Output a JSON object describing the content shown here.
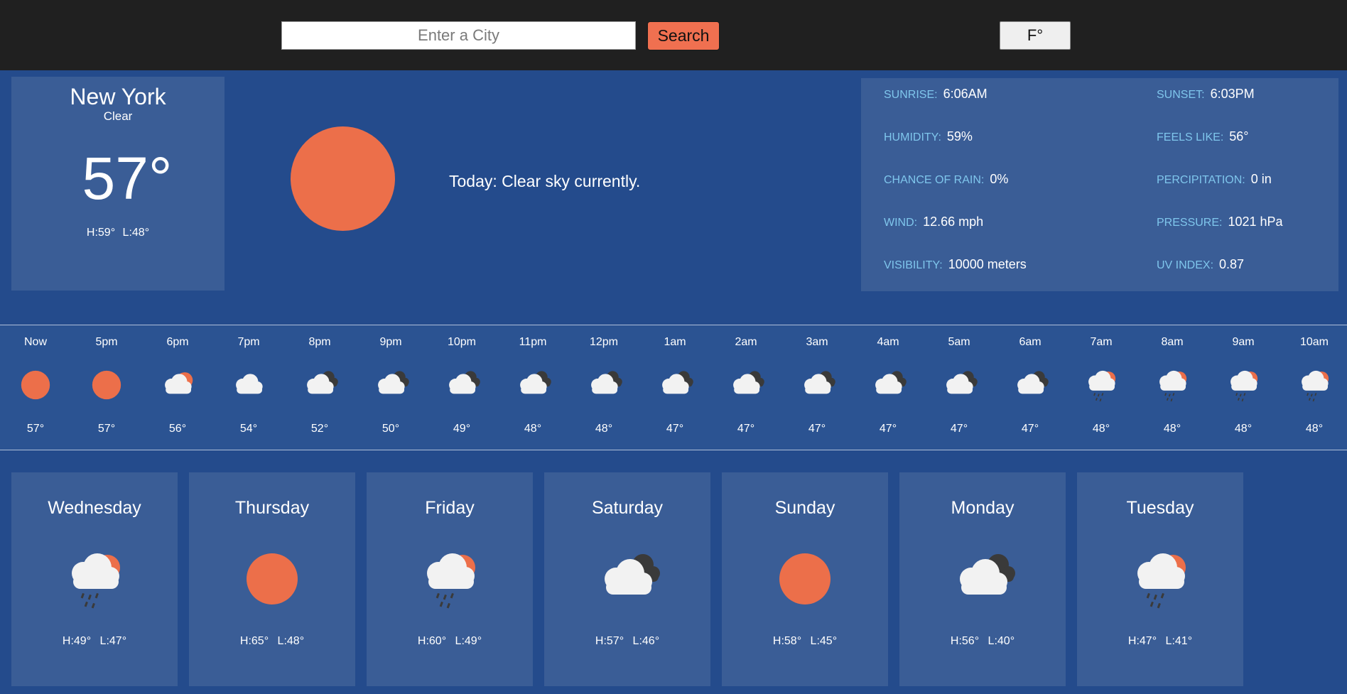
{
  "search": {
    "placeholder": "Enter a City",
    "button_label": "Search"
  },
  "unit_toggle": {
    "label": "F°"
  },
  "current": {
    "city": "New York",
    "condition": "Clear",
    "temp": "57°",
    "high": "H:59°",
    "low": "L:48°",
    "icon": "sun-icon",
    "summary": "Today: Clear sky currently."
  },
  "details": [
    {
      "label": "SUNRISE:",
      "value": "6:06AM"
    },
    {
      "label": "SUNSET:",
      "value": "6:03PM"
    },
    {
      "label": "HUMIDITY:",
      "value": "59%"
    },
    {
      "label": "FEELS LIKE:",
      "value": "56°"
    },
    {
      "label": "CHANCE OF RAIN:",
      "value": "0%"
    },
    {
      "label": "PERCIPITATION:",
      "value": "0 in"
    },
    {
      "label": "WIND:",
      "value": "12.66 mph"
    },
    {
      "label": "PRESSURE:",
      "value": "1021 hPa"
    },
    {
      "label": "VISIBILITY:",
      "value": "10000 meters"
    },
    {
      "label": "UV INDEX:",
      "value": "0.87"
    }
  ],
  "hourly": [
    {
      "time": "Now",
      "temp": "57°",
      "icon": "sun-icon"
    },
    {
      "time": "5pm",
      "temp": "57°",
      "icon": "sun-icon"
    },
    {
      "time": "6pm",
      "temp": "56°",
      "icon": "partly-cloudy-icon"
    },
    {
      "time": "7pm",
      "temp": "54°",
      "icon": "cloud-icon"
    },
    {
      "time": "8pm",
      "temp": "52°",
      "icon": "overcast-icon"
    },
    {
      "time": "9pm",
      "temp": "50°",
      "icon": "overcast-icon"
    },
    {
      "time": "10pm",
      "temp": "49°",
      "icon": "overcast-icon"
    },
    {
      "time": "11pm",
      "temp": "48°",
      "icon": "overcast-icon"
    },
    {
      "time": "12pm",
      "temp": "48°",
      "icon": "overcast-icon"
    },
    {
      "time": "1am",
      "temp": "47°",
      "icon": "overcast-icon"
    },
    {
      "time": "2am",
      "temp": "47°",
      "icon": "overcast-icon"
    },
    {
      "time": "3am",
      "temp": "47°",
      "icon": "overcast-icon"
    },
    {
      "time": "4am",
      "temp": "47°",
      "icon": "overcast-icon"
    },
    {
      "time": "5am",
      "temp": "47°",
      "icon": "overcast-icon"
    },
    {
      "time": "6am",
      "temp": "47°",
      "icon": "overcast-icon"
    },
    {
      "time": "7am",
      "temp": "48°",
      "icon": "sun-rain-icon"
    },
    {
      "time": "8am",
      "temp": "48°",
      "icon": "sun-rain-icon"
    },
    {
      "time": "9am",
      "temp": "48°",
      "icon": "sun-rain-icon"
    },
    {
      "time": "10am",
      "temp": "48°",
      "icon": "sun-rain-icon"
    }
  ],
  "daily": [
    {
      "day": "Wednesday",
      "high": "H:49°",
      "low": "L:47°",
      "icon": "sun-rain-icon"
    },
    {
      "day": "Thursday",
      "high": "H:65°",
      "low": "L:48°",
      "icon": "sun-icon"
    },
    {
      "day": "Friday",
      "high": "H:60°",
      "low": "L:49°",
      "icon": "sun-rain-icon"
    },
    {
      "day": "Saturday",
      "high": "H:57°",
      "low": "L:46°",
      "icon": "overcast-icon"
    },
    {
      "day": "Sunday",
      "high": "H:58°",
      "low": "L:45°",
      "icon": "sun-icon"
    },
    {
      "day": "Monday",
      "high": "H:56°",
      "low": "L:40°",
      "icon": "overcast-icon"
    },
    {
      "day": "Tuesday",
      "high": "H:47°",
      "low": "L:41°",
      "icon": "sun-rain-icon"
    }
  ],
  "colors": {
    "sun": "#ec6f4a",
    "cloud": "#f2f2f2",
    "dark_cloud": "#3a3a3a",
    "label": "#7fc6ec",
    "accent_button": "#f07050"
  }
}
